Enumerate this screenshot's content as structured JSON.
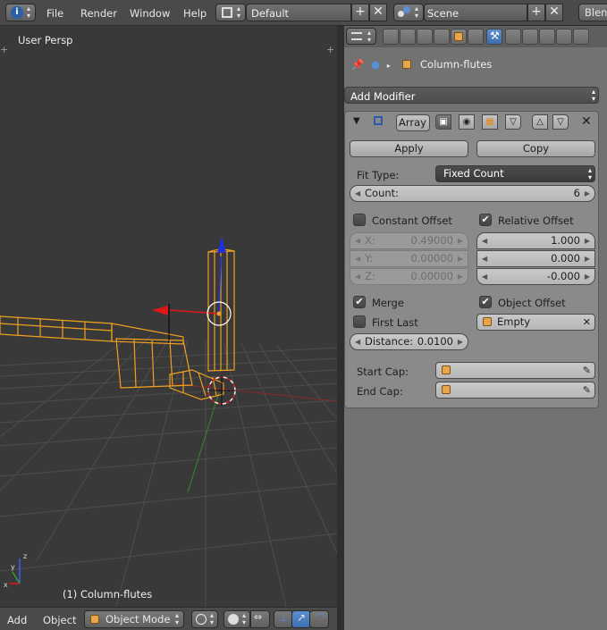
{
  "topbar": {
    "menus": [
      "File",
      "Render",
      "Window",
      "Help"
    ],
    "screen_layout": "Default",
    "scene": "Scene",
    "engine_partial": "Blend"
  },
  "viewport": {
    "title": "User Persp",
    "active_object": "(1) Column-flutes"
  },
  "bottombar": {
    "add_label": "Add",
    "object_label": "Object",
    "mode": "Object Mode"
  },
  "properties": {
    "breadcrumb_object": "Column-flutes",
    "add_modifier": "Add Modifier",
    "modifier": {
      "name": "Array",
      "apply_label": "Apply",
      "copy_label": "Copy",
      "fit_type_label": "Fit Type:",
      "fit_type_value": "Fixed Count",
      "count_label": "Count:",
      "count_value": "6",
      "constant_offset": {
        "label": "Constant Offset",
        "checked": false
      },
      "relative_offset": {
        "label": "Relative Offset",
        "checked": true
      },
      "constant_values": [
        {
          "key": "X:",
          "value": "0.49000"
        },
        {
          "key": "Y:",
          "value": "0.00000"
        },
        {
          "key": "Z:",
          "value": "0.00000"
        }
      ],
      "relative_values": [
        "1.000",
        "0.000",
        "-0.000"
      ],
      "merge": {
        "label": "Merge",
        "checked": true
      },
      "first_last": {
        "label": "First Last",
        "checked": false
      },
      "object_offset": {
        "label": "Object Offset",
        "checked": true
      },
      "offset_object": "Empty",
      "distance_label": "Distance:",
      "distance_value": "0.0100",
      "start_cap_label": "Start Cap:",
      "end_cap_label": "End Cap:"
    }
  },
  "colors": {
    "selection_orange": "#f0a020",
    "active_tab_blue": "#4a7ec4",
    "x_axis_red": "#d01818",
    "z_axis_blue": "#2040e0"
  }
}
